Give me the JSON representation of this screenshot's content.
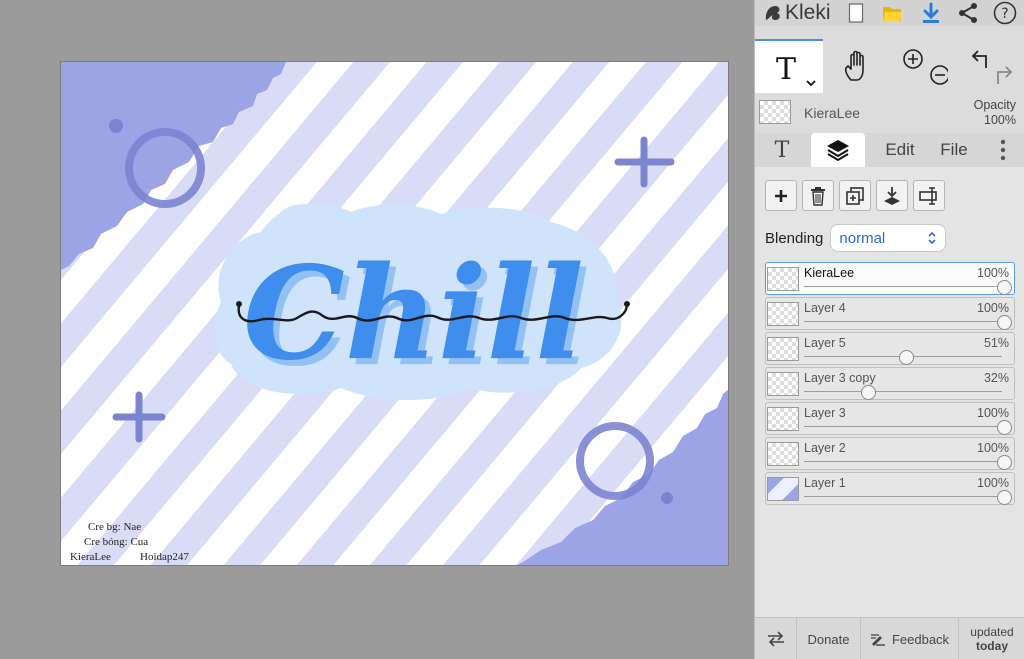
{
  "app": {
    "name": "Kleki"
  },
  "canvas": {
    "main_text": "Chill",
    "script_text": "chill",
    "credits": [
      "Cre bg: Nae",
      "Cre bóng: Cua",
      "KieraLee",
      "Hoidap247"
    ]
  },
  "layer_header": {
    "name": "KieraLee",
    "opacity_label": "Opacity",
    "opacity_value": "100%"
  },
  "tabs": {
    "text_tab": "T",
    "edit": "Edit",
    "file": "File"
  },
  "blending": {
    "label": "Blending",
    "value": "normal"
  },
  "layers": [
    {
      "name": "KieraLee",
      "opacity": "100%",
      "value": 100,
      "active": true
    },
    {
      "name": "Layer 4",
      "opacity": "100%",
      "value": 100,
      "active": false
    },
    {
      "name": "Layer 5",
      "opacity": "51%",
      "value": 51,
      "active": false
    },
    {
      "name": "Layer 3 copy",
      "opacity": "32%",
      "value": 32,
      "active": false
    },
    {
      "name": "Layer 3",
      "opacity": "100%",
      "value": 100,
      "active": false
    },
    {
      "name": "Layer 2",
      "opacity": "100%",
      "value": 100,
      "active": false
    },
    {
      "name": "Layer 1",
      "opacity": "100%",
      "value": 100,
      "active": false
    }
  ],
  "bottom": {
    "donate": "Donate",
    "feedback": "Feedback",
    "updated_line1": "updated",
    "updated_line2": "today"
  },
  "colors": {
    "accent": "#4a8fe0",
    "blend_text": "#2a6ad8",
    "stripe": "#d9dcf6",
    "corner": "#9da4e6",
    "bubble": "#cfe3fb",
    "letters": "#3f8ded"
  },
  "icons": [
    "kleki-logo-icon",
    "new-file-icon",
    "open-folder-icon",
    "download-icon",
    "share-icon",
    "help-icon",
    "text-tool-icon",
    "hand-tool-icon",
    "zoom-in-icon",
    "zoom-out-icon",
    "undo-icon",
    "redo-icon",
    "add-layer-icon",
    "delete-layer-icon",
    "duplicate-layer-icon",
    "merge-down-icon",
    "rename-layer-icon",
    "swap-icon",
    "feedback-icon",
    "more-icon"
  ]
}
